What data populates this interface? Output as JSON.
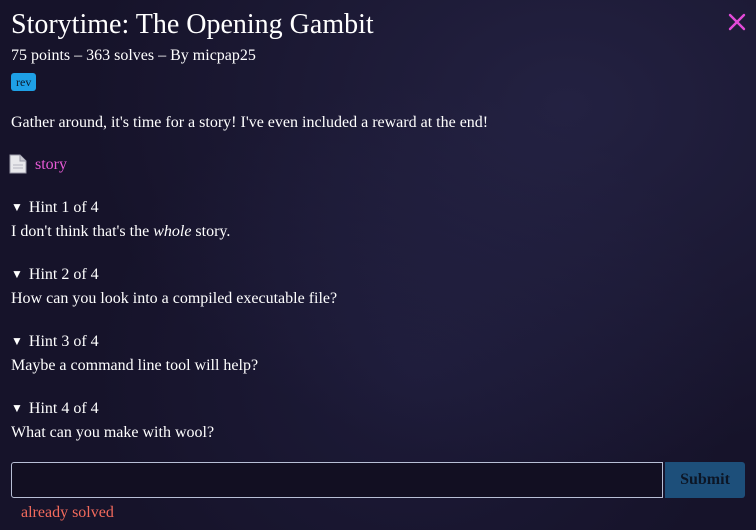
{
  "challenge": {
    "title": "Storytime: The Opening Gambit",
    "points": "75 points",
    "solves": "363 solves",
    "author": "By micpap25",
    "tag": "rev",
    "description": "Gather around, it's time for a story! I've even included a reward at the end!",
    "file_name": "story",
    "file_icon": "file-icon",
    "close_icon": "close-icon"
  },
  "hints": [
    {
      "summary": "Hint 1 of 4",
      "text_before": "I don't think that's the ",
      "text_em": "whole",
      "text_after": " story."
    },
    {
      "summary": "Hint 2 of 4",
      "text": "How can you look into a compiled executable file?"
    },
    {
      "summary": "Hint 3 of 4",
      "text": "Maybe a command line tool will help?"
    },
    {
      "summary": "Hint 4 of 4",
      "text": "What can you make with wool?"
    }
  ],
  "submission": {
    "input_value": "",
    "placeholder": "",
    "submit_label": "Submit",
    "status": "already solved"
  },
  "colors": {
    "close": "#e24ad8",
    "link": "#e85ad6",
    "tag_bg": "#1ea0e6",
    "submit_bg": "#1d4f7a",
    "status": "#f26a5c"
  }
}
